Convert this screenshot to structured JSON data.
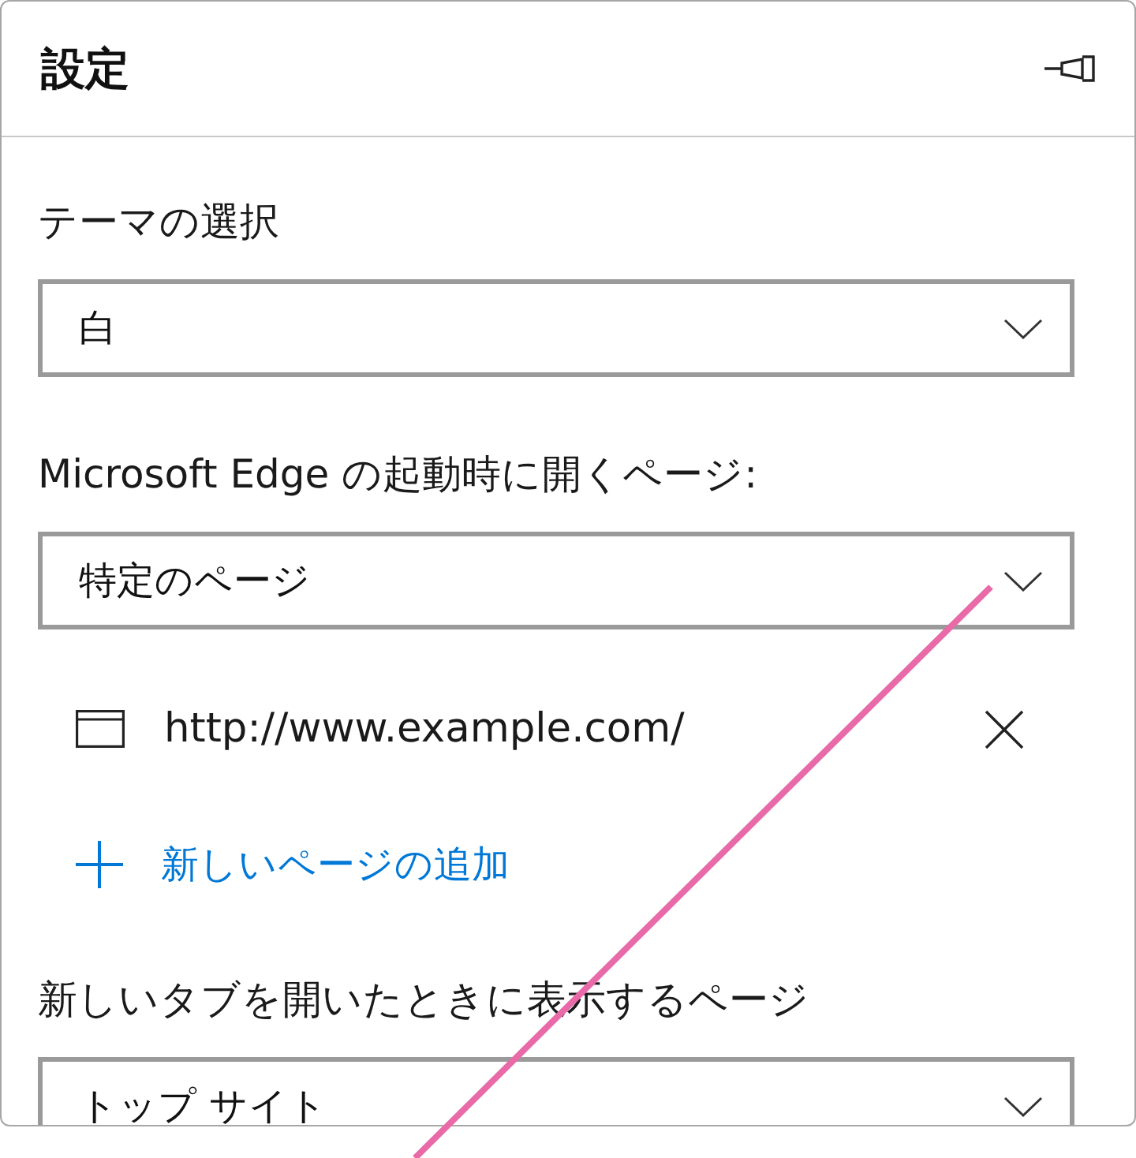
{
  "panel": {
    "title": "設定"
  },
  "sections": [
    {
      "label": "テーマの選択",
      "value": "白"
    },
    {
      "label": "Microsoft Edge の起動時に開くページ:",
      "value": "特定のページ",
      "pages": [
        {
          "url": "http://www.example.com/"
        }
      ],
      "add_page": "新しいページの追加"
    },
    {
      "label": "新しいタブを開いたときに表示するページ",
      "value": "トップ サイト"
    }
  ]
}
